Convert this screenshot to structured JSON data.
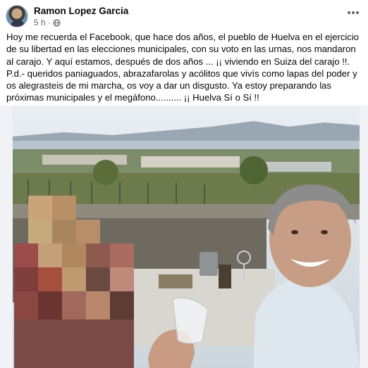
{
  "post": {
    "author": "Ramon Lopez Garcia",
    "time": "5 h",
    "separator": "·",
    "paragraph1": "Hoy me recuerda el Facebook, que hace dos años, el pueblo de Huelva en el ejercicio de su libertad en las elecciones municipales, con su voto en las urnas, nos mandaron al carajo. Y aquí estamos, después de dos años ... ¡¡ viviendo en Suiza del carajo !!.",
    "paragraph2": "P.d.- queridos paniaguados, abrazafarolas y acólitos que vivís como lapas del poder y os alegrasteis de mi marcha, os voy a dar un disgusto. Ya estoy preparando las próximas municipales y el megáfono.......... ¡¡ Huelva Sí o Sí !!"
  },
  "icons": {
    "avatar": "profile-avatar",
    "privacy": "globe-icon",
    "more": "more-options-icon"
  },
  "colors": {
    "name": "#050505",
    "meta": "#65676b",
    "background": "#ffffff"
  }
}
